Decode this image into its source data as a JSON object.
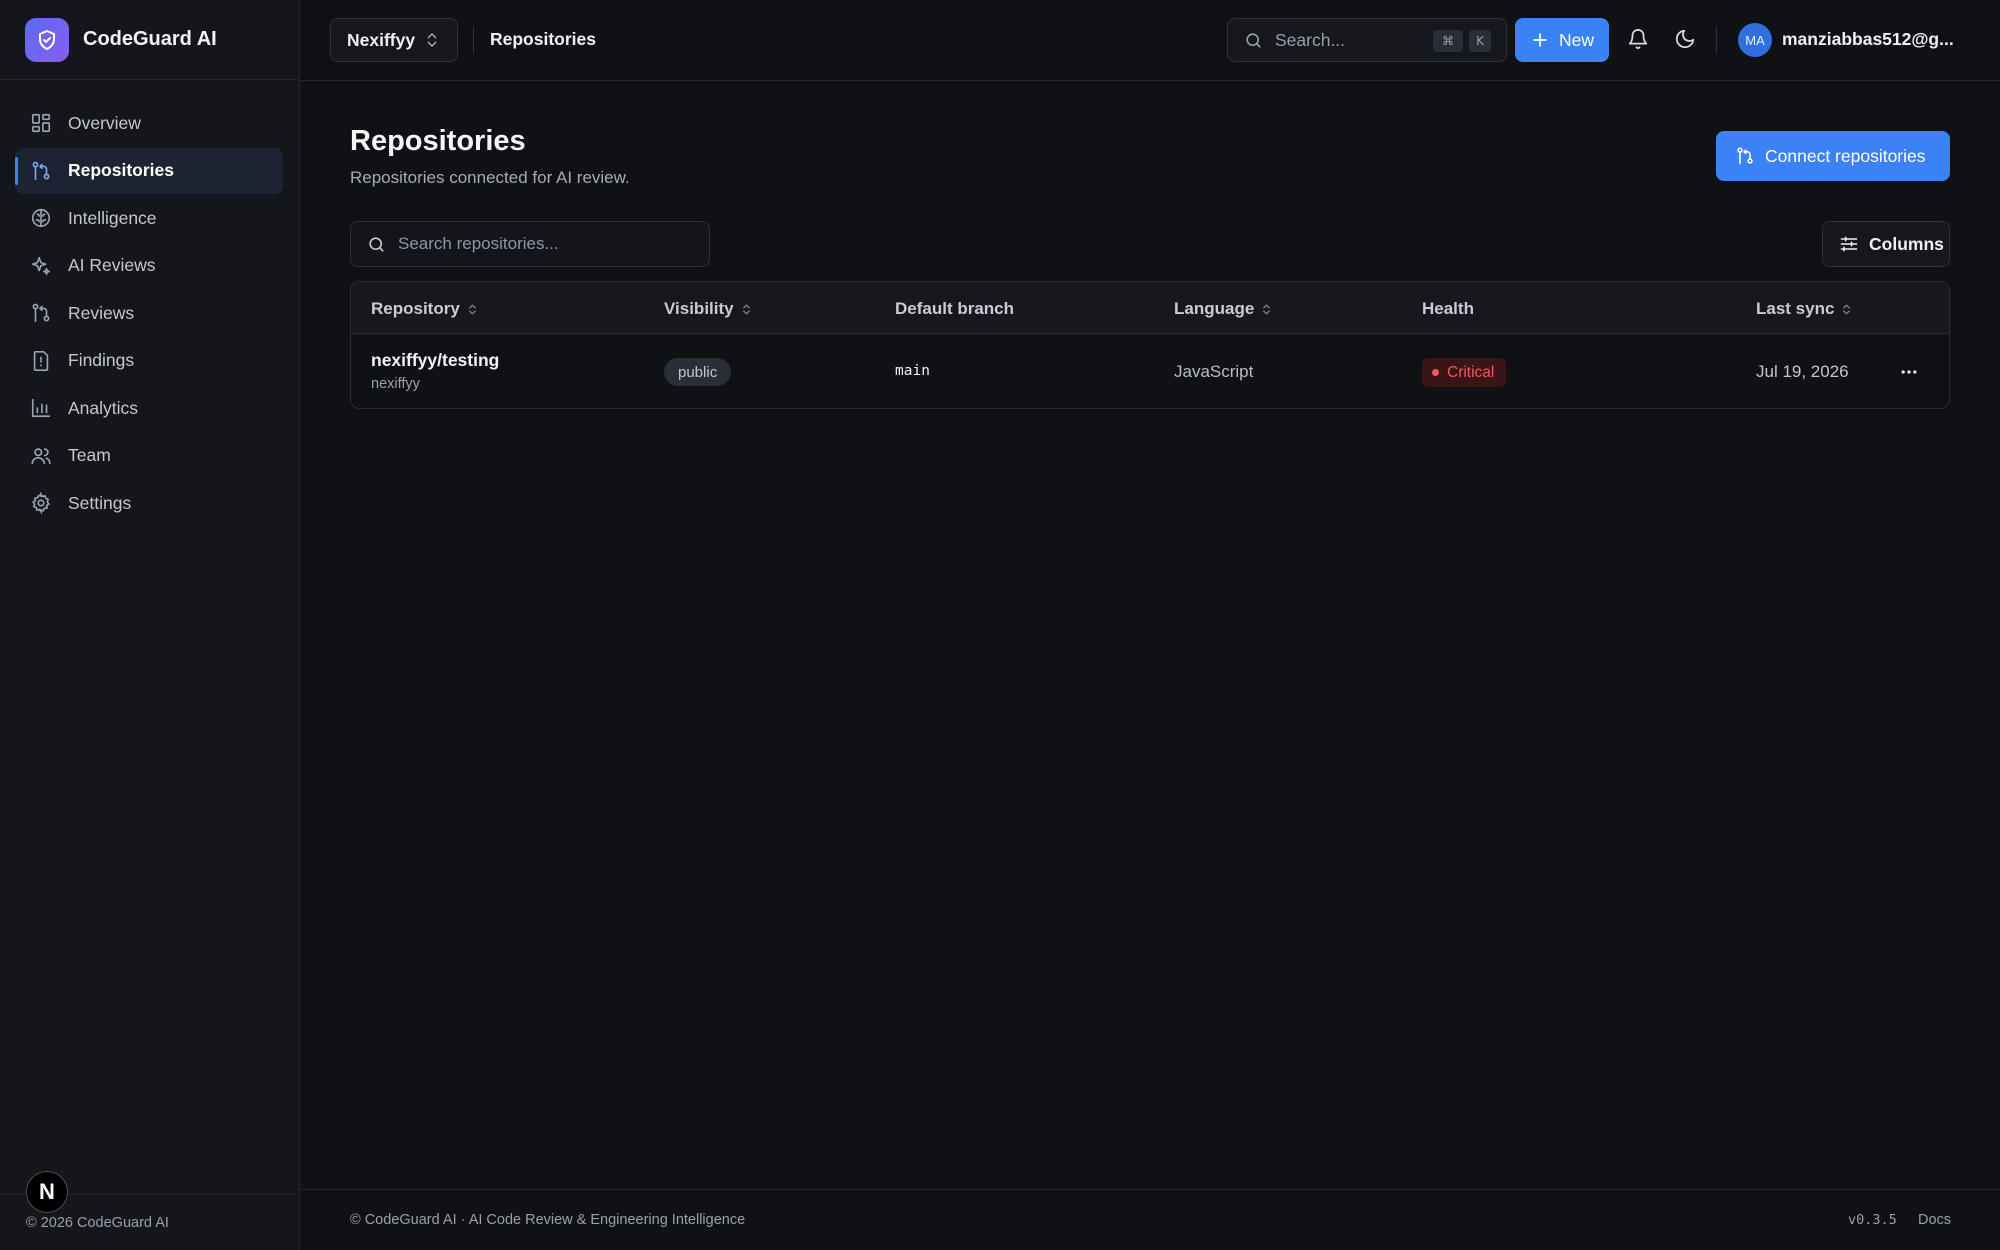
{
  "app": {
    "name": "CodeGuard AI"
  },
  "sidebar": {
    "items": [
      {
        "label": "Overview",
        "icon": "grid-icon"
      },
      {
        "label": "Repositories",
        "icon": "git-branch-icon",
        "active": true
      },
      {
        "label": "Intelligence",
        "icon": "brain-icon"
      },
      {
        "label": "AI Reviews",
        "icon": "sparkles-icon"
      },
      {
        "label": "Reviews",
        "icon": "git-pull-request-icon"
      },
      {
        "label": "Findings",
        "icon": "file-alert-icon"
      },
      {
        "label": "Analytics",
        "icon": "bar-chart-icon"
      },
      {
        "label": "Team",
        "icon": "users-icon"
      },
      {
        "label": "Settings",
        "icon": "gear-icon"
      }
    ],
    "footer": "© 2026 CodeGuard AI",
    "badge_letter": "N"
  },
  "header": {
    "workspace": "Nexiffyy",
    "breadcrumb": "Repositories",
    "search_placeholder": "Search...",
    "shortcut_mod": "⌘",
    "shortcut_key": "K",
    "new_label": "New",
    "avatar_initials": "MA",
    "user_email": "manziabbas512@g..."
  },
  "page": {
    "title": "Repositories",
    "subtitle": "Repositories connected for AI review.",
    "connect_label": "Connect repositories",
    "search_placeholder": "Search repositories...",
    "columns_label": "Columns"
  },
  "table": {
    "headers": {
      "repository": "Repository",
      "visibility": "Visibility",
      "default_branch": "Default branch",
      "language": "Language",
      "health": "Health",
      "last_sync": "Last sync"
    },
    "rows": [
      {
        "name": "nexiffyy/testing",
        "owner": "nexiffyy",
        "visibility": "public",
        "branch": "main",
        "language": "JavaScript",
        "health": "Critical",
        "last_sync": "Jul 19, 2026"
      }
    ]
  },
  "footer": {
    "text": "© CodeGuard AI · AI Code Review & Engineering Intelligence",
    "version": "v0.3.5",
    "docs": "Docs"
  },
  "colors": {
    "accent": "#3b82f6",
    "background": "#0f1115",
    "critical": "#f05a5a"
  }
}
